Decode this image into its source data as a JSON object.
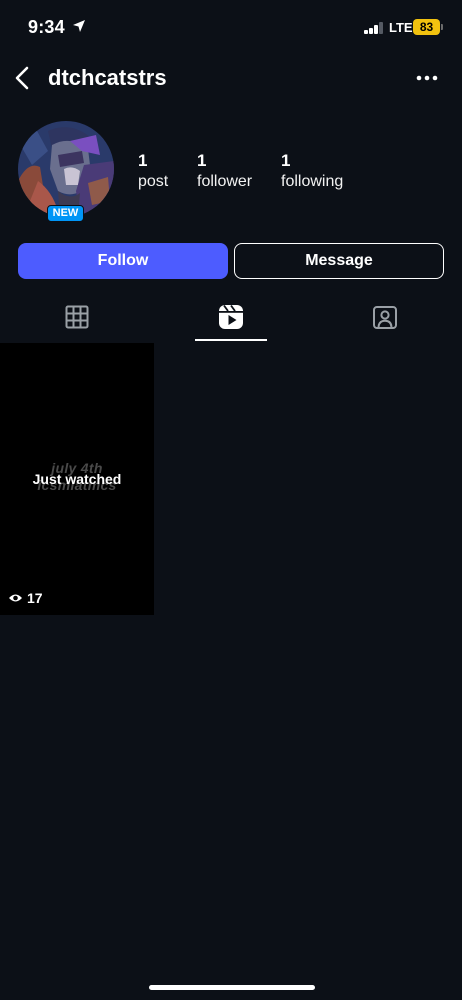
{
  "status_bar": {
    "time": "9:34",
    "network": "LTE",
    "battery": "83"
  },
  "header": {
    "username": "dtchcatstrs"
  },
  "profile": {
    "badge": "NEW",
    "stats": [
      {
        "value": "1",
        "label": "post"
      },
      {
        "value": "1",
        "label": "follower"
      },
      {
        "value": "1",
        "label": "following"
      }
    ]
  },
  "actions": {
    "follow": "Follow",
    "message": "Message"
  },
  "tabs": [
    {
      "icon": "grid-icon",
      "active": false
    },
    {
      "icon": "reels-icon",
      "active": true
    },
    {
      "icon": "tagged-icon",
      "active": false
    }
  ],
  "posts": [
    {
      "overlay_line1": "july 4th",
      "overlay_line2": "icsmiatmcs",
      "status": "Just watched",
      "views": "17",
      "icon": "eye-icon"
    }
  ],
  "colors": {
    "background": "#0c1017",
    "accent": "#4d5cff",
    "badge": "#0095f6",
    "battery": "#f2c20f"
  }
}
